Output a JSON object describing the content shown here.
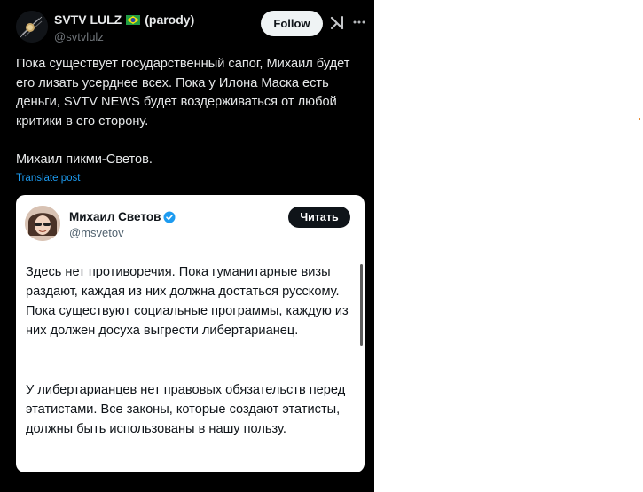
{
  "tweet": {
    "author_name": "SVTV LULZ",
    "author_tag": "(parody)",
    "author_handle": "@svtvlulz",
    "follow_label": "Follow",
    "more_icon": "more-horizontal-icon",
    "grok_icon": "grok-icon",
    "text": "Пока существует государственный сапог, Михаил будет его лизать усерднее всех. Пока у Илона Маска есть деньги, SVTV NEWS будет воздерживаться от любой критики в его сторону.\n\nМихаил пикми-Светов.",
    "translate_label": "Translate post"
  },
  "quote": {
    "name": "Михаил Светов",
    "handle": "@msvetov",
    "read_label": "Читать",
    "paragraph1": "Здесь нет противоречия. Пока гуманитарные визы раздают, каждая из них должна достаться русскому. Пока существуют социальные программы, каждую из них должен досуха выгрести либертарианец.",
    "paragraph2": "У либертарианцев нет правовых обязательств перед этатистами. Все законы, которые создают этатисты, должны быть использованы в нашу пользу."
  },
  "colors": {
    "background": "#000000",
    "text": "#e7e9ea",
    "muted": "#71767b",
    "link": "#1d9bf0",
    "verified": "#1d9bf0"
  }
}
